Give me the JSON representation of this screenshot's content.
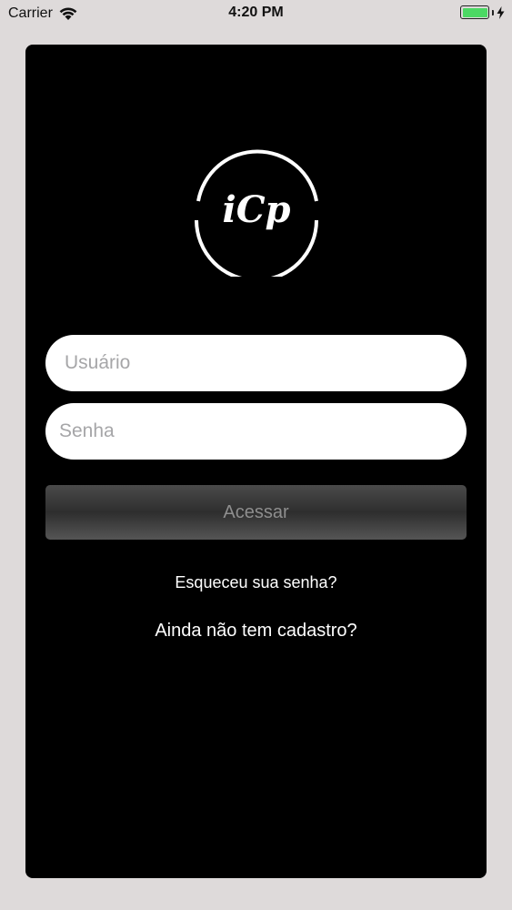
{
  "status_bar": {
    "carrier": "Carrier",
    "time": "4:20 PM",
    "battery_level": 1.0,
    "battery_color": "#4cd964"
  },
  "logo": {
    "text": "iCp",
    "icon": "icp-logo-icon"
  },
  "login": {
    "username_placeholder": "Usuário",
    "password_placeholder": "Senha",
    "access_label": "Acessar",
    "forgot_label": "Esqueceu sua senha?",
    "register_label": "Ainda não tem cadastro?"
  },
  "colors": {
    "background": "#dedada",
    "card": "#000000",
    "input_bg": "#ffffff",
    "placeholder": "#a6a6a8",
    "button_text": "#8e8e8e"
  }
}
